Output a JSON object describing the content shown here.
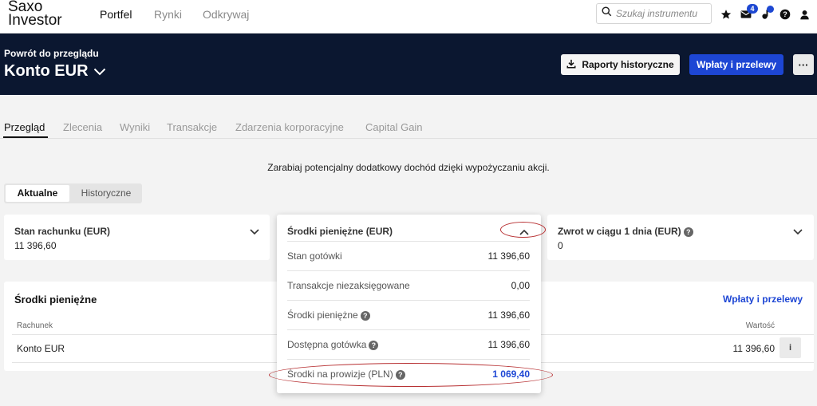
{
  "brand": {
    "line1": "Saxo",
    "line2": "Investor"
  },
  "nav": {
    "items": [
      "Portfel",
      "Rynki",
      "Odkrywaj"
    ]
  },
  "search": {
    "placeholder": "Szukaj instrumentu"
  },
  "topbar": {
    "messages_badge": "4"
  },
  "header": {
    "back_label": "Powrót do przeglądu",
    "account_title": "Konto EUR",
    "historical_reports": "Raporty historyczne",
    "payments": "Wpłaty i przelewy",
    "more": "···"
  },
  "tabs": [
    "Przegląd",
    "Zlecenia",
    "Wyniki",
    "Transakcje",
    "Zdarzenia korporacyjne",
    "Capital Gain"
  ],
  "promo": "Zarabiaj potencjalny dodatkowy dochód dzięki wypożyczaniu akcji.",
  "toggle": {
    "current": "Aktualne",
    "historical": "Historyczne"
  },
  "cards": {
    "account_state": {
      "title": "Stan rachunku (EUR)",
      "value": "11 396,60"
    },
    "cash_funds": {
      "title": "Środki pieniężne (EUR)"
    },
    "return_1d": {
      "title": "Zwrot w ciągu 1 dnia (EUR)",
      "value": "0"
    }
  },
  "cash_dropdown": {
    "rows": [
      {
        "label": "Stan gotówki",
        "value": "11 396,60"
      },
      {
        "label": "Transakcje niezaksięgowane",
        "value": "0,00"
      },
      {
        "label": "Środki pieniężne",
        "value": "11 396,60"
      },
      {
        "label": "Dostępna gotówka",
        "value": "11 396,60"
      },
      {
        "label": "Środki na prowizje (PLN)",
        "value": "1 069,40"
      }
    ]
  },
  "cash_section": {
    "title": "Środki pieniężne",
    "link": "Wpłaty i przelewy",
    "col_account": "Rachunek",
    "col_value": "Wartość",
    "row_account": "Konto EUR",
    "row_value": "11 396,60",
    "info": "i"
  },
  "colors": {
    "header_bg": "#0b1730",
    "accent": "#1d46d4",
    "annotation": "#b83234"
  }
}
